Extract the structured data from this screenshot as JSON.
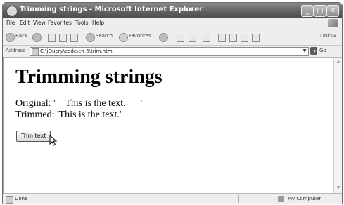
{
  "window": {
    "title": "Trimming strings - Microsoft Internet Explorer",
    "controls": {
      "min": "_",
      "max": "□",
      "close": "✕"
    }
  },
  "menubar": {
    "items": [
      "File",
      "Edit",
      "View",
      "Favorites",
      "Tools",
      "Help"
    ]
  },
  "toolbar": {
    "back": "Back",
    "search": "Search",
    "favorites": "Favorites",
    "links": "Links",
    "more": "»"
  },
  "addressbar": {
    "label": "Address",
    "url": "C:\\jQuery\\code\\ch-6\\trim.html",
    "go": "Go"
  },
  "page": {
    "heading": "Trimming strings",
    "original": "Original: '    This is the text.      '",
    "trimmed": "Trimmed: 'This is the text.'",
    "button": "Trim text"
  },
  "statusbar": {
    "status": "Done",
    "zone": "My Computer"
  },
  "icons": {
    "app": "ie-logo-icon",
    "winlogo": "windows-logo-icon",
    "cursor": "mouse-cursor-icon"
  }
}
